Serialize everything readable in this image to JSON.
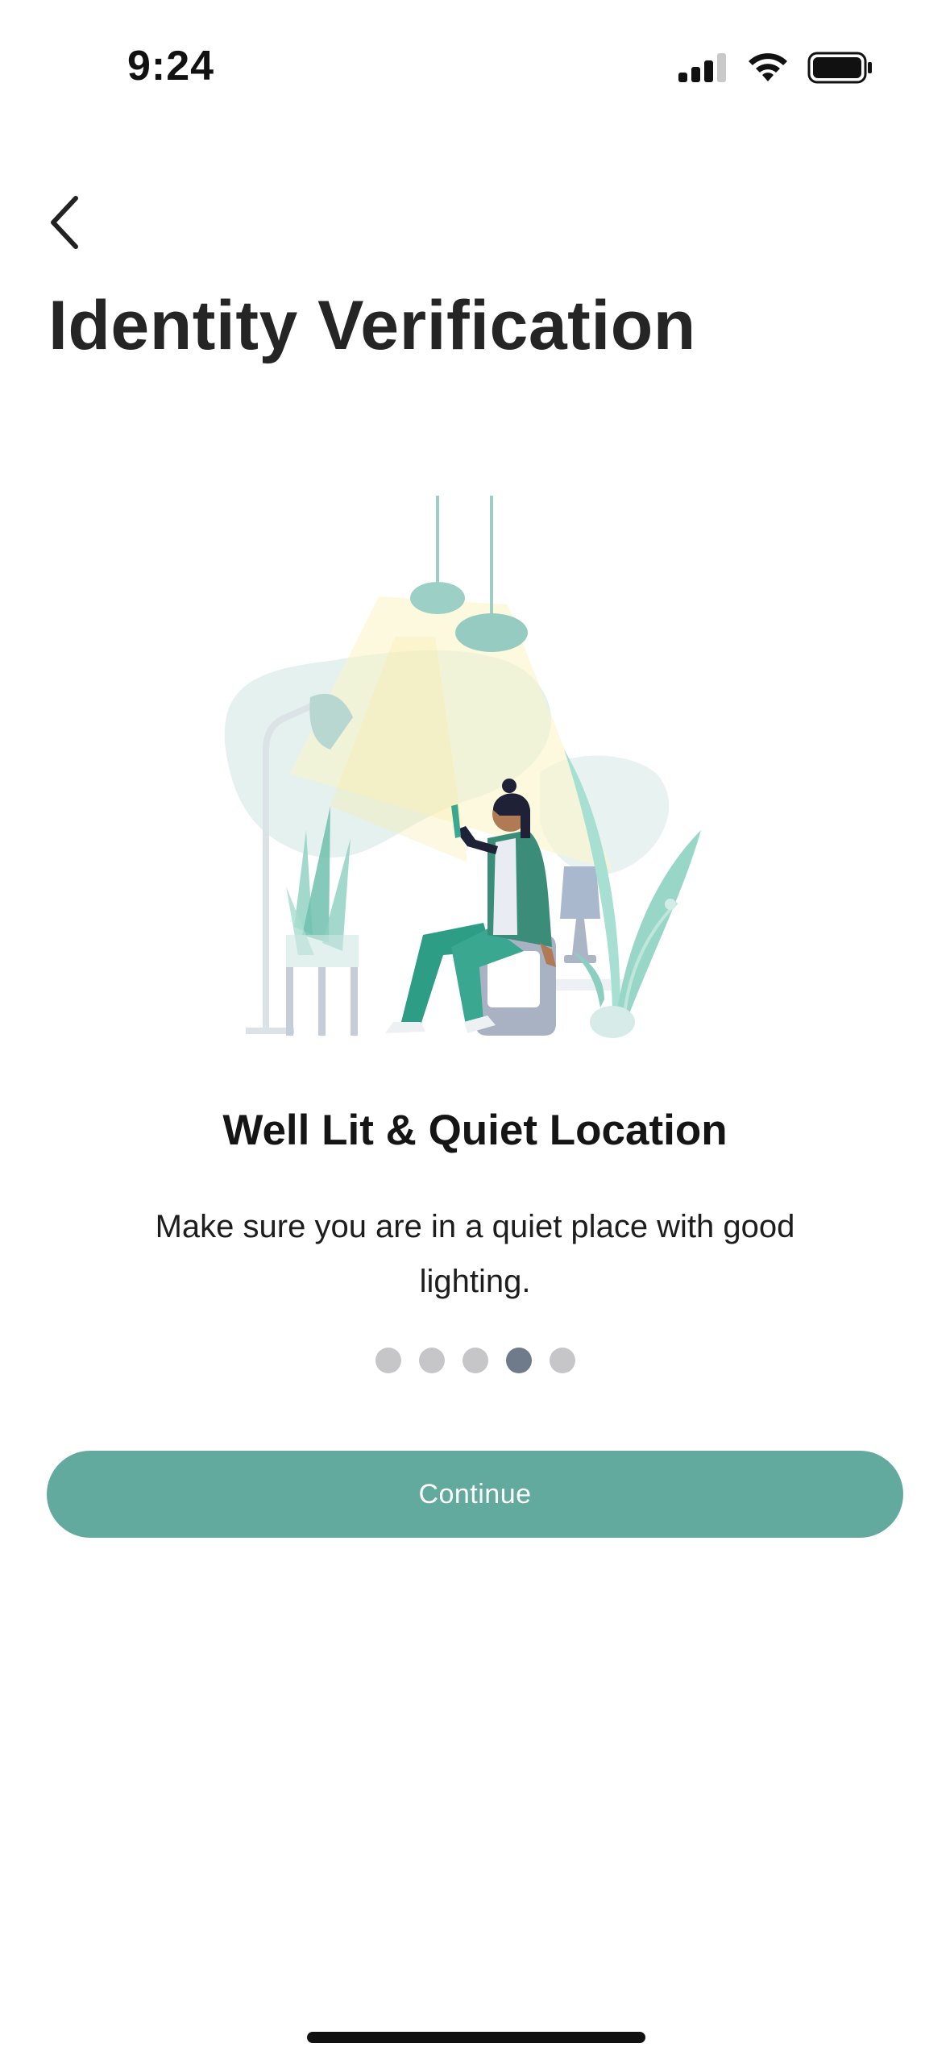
{
  "status_bar": {
    "time": "9:24"
  },
  "header": {
    "title": "Identity Verification"
  },
  "icons": {
    "back": "chevron-left-icon",
    "signal": "cellular-signal-icon",
    "wifi": "wifi-icon",
    "battery": "battery-icon"
  },
  "onboarding": {
    "title": "Well Lit & Quiet Location",
    "body": "Make sure you are in a quiet place with good lighting.",
    "page_count": 5,
    "active_page": 4
  },
  "continue_label": "Continue",
  "colors": {
    "accent": "#62aa9e",
    "dot_active": "#6f7a8a",
    "dot_inactive": "#c6c6c8"
  }
}
